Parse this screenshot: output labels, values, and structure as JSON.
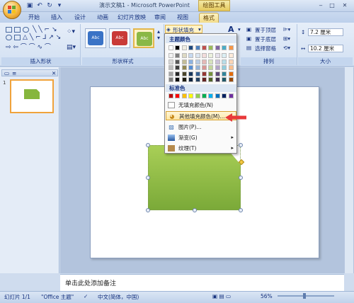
{
  "window": {
    "title": "演示文稿1 - Microsoft PowerPoint",
    "context_tool": "绘图工具"
  },
  "tabs": [
    {
      "label": "开始"
    },
    {
      "label": "插入"
    },
    {
      "label": "设计"
    },
    {
      "label": "动画"
    },
    {
      "label": "幻灯片放映"
    },
    {
      "label": "审阅"
    },
    {
      "label": "视图"
    },
    {
      "label": "格式"
    }
  ],
  "ribbon": {
    "insert_shapes_label": "插入形状",
    "shape_styles_label": "形状样式",
    "arrange_label": "排列",
    "size_label": "大小",
    "style_buttons": [
      {
        "text": "Abc",
        "color": "#3a73c6"
      },
      {
        "text": "Abc",
        "color": "#c93a37"
      },
      {
        "text": "Abc",
        "color": "#8ab846"
      }
    ],
    "shape_fill_label": "形状填充",
    "bring_front": "置于顶层",
    "send_back": "置于底层",
    "selection_pane": "选择窗格",
    "height": "7.2 厘米",
    "width": "10.2 厘米"
  },
  "menu": {
    "theme_colors_header": "主题颜色",
    "standard_colors_header": "标准色",
    "theme_top_row": [
      "#ffffff",
      "#000000",
      "#eeece1",
      "#1f497d",
      "#4f81bd",
      "#c0504d",
      "#9bbb59",
      "#8064a2",
      "#4bacc6",
      "#f79646"
    ],
    "theme_columns": [
      [
        "#f2f2f2",
        "#d8d8d8",
        "#bfbfbf",
        "#a5a5a5",
        "#7f7f7f"
      ],
      [
        "#7f7f7f",
        "#595959",
        "#3f3f3f",
        "#262626",
        "#0c0c0c"
      ],
      [
        "#ddd9c3",
        "#c4bd97",
        "#938953",
        "#494429",
        "#1d1b10"
      ],
      [
        "#c6d9f0",
        "#8db3e2",
        "#548dd4",
        "#17365d",
        "#0f243e"
      ],
      [
        "#dbe5f1",
        "#b8cce4",
        "#95b3d7",
        "#366092",
        "#244061"
      ],
      [
        "#f2dcdb",
        "#e5b9b7",
        "#d99694",
        "#953734",
        "#632423"
      ],
      [
        "#ebf1dd",
        "#d7e3bc",
        "#c3d69b",
        "#76923c",
        "#4f6128"
      ],
      [
        "#e5e0ec",
        "#ccc1d9",
        "#b2a2c7",
        "#5f497a",
        "#3f3151"
      ],
      [
        "#dbeef3",
        "#b7dde8",
        "#92cddc",
        "#31859b",
        "#205867"
      ],
      [
        "#fdeada",
        "#fbd5b5",
        "#fac08f",
        "#e36c09",
        "#974806"
      ]
    ],
    "standard_colors": [
      "#c00000",
      "#ff0000",
      "#ffc000",
      "#ffff00",
      "#92d050",
      "#00b050",
      "#00b0f0",
      "#0070c0",
      "#002060",
      "#7030a0"
    ],
    "items": [
      {
        "label": "无填充颜色(N)",
        "icon": "no-fill-icon"
      },
      {
        "label": "其他填充颜色(M)...",
        "icon": "palette-icon"
      },
      {
        "label": "图片(P)...",
        "icon": "picture-icon"
      },
      {
        "label": "渐变(G)",
        "icon": "gradient-icon"
      },
      {
        "label": "纹理(T)",
        "icon": "texture-icon"
      }
    ]
  },
  "slide_panel": {
    "slide_number": "1"
  },
  "notes": {
    "placeholder": "单击此处添加备注"
  },
  "status": {
    "slide": "幻灯片 1/1",
    "theme": "\"Office 主题\"",
    "language": "中文(简体，中国)",
    "zoom": "56%"
  },
  "colors": {
    "shape_fill": "#8ab846",
    "highlight_border": "#d8a130",
    "arrow": "#e8393a"
  }
}
